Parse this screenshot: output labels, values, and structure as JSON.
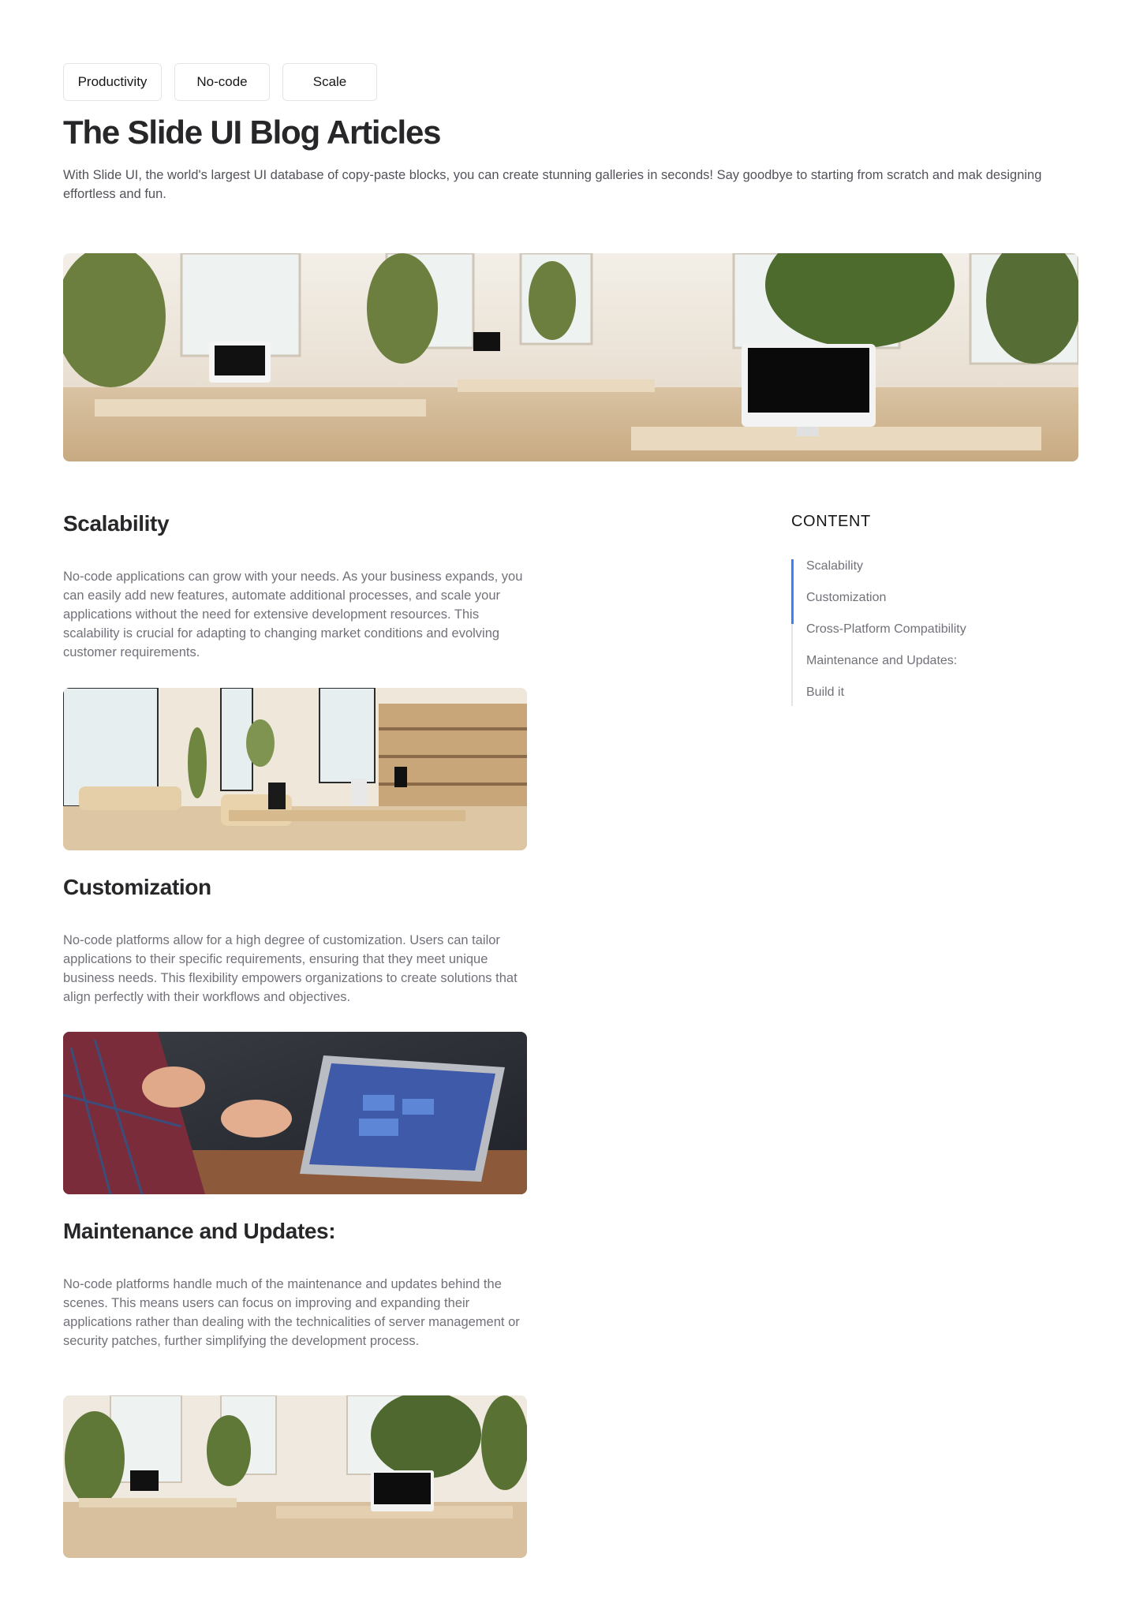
{
  "tags": [
    "Productivity",
    "No-code",
    "Scale"
  ],
  "header": {
    "title": "The Slide UI Blog Articles",
    "intro": "With Slide UI, the world's largest UI database of copy-paste blocks, you can create stunning galleries in seconds! Say goodbye to starting from scratch and mak designing effortless and fun."
  },
  "sections": [
    {
      "title": "Scalability",
      "body": "No-code applications can grow with your needs. As your business expands, you can easily add new features, automate additional processes, and scale your applications without the need for extensive development resources. This scalability is crucial for adapting to changing market conditions and evolving customer requirements."
    },
    {
      "title": "Customization",
      "body": "No-code platforms allow for a high degree of customization. Users can tailor applications to their specific requirements, ensuring that they meet unique business needs. This flexibility empowers organizations to create solutions that align perfectly with their workflows and objectives."
    },
    {
      "title": "Maintenance and Updates:",
      "body": "No-code platforms handle much of the maintenance and updates behind the scenes. This means users can focus on improving and expanding their applications rather than dealing with the technicalities of server management or security patches, further simplifying the development process."
    }
  ],
  "toc": {
    "heading": "CONTENT",
    "items": [
      "Scalability",
      "Customization",
      "Cross-Platform Compatibility",
      "Maintenance and Updates:",
      "Build it"
    ]
  },
  "colors": {
    "accent": "#3b82f6",
    "text": "#27272a",
    "muted": "#71717a"
  }
}
